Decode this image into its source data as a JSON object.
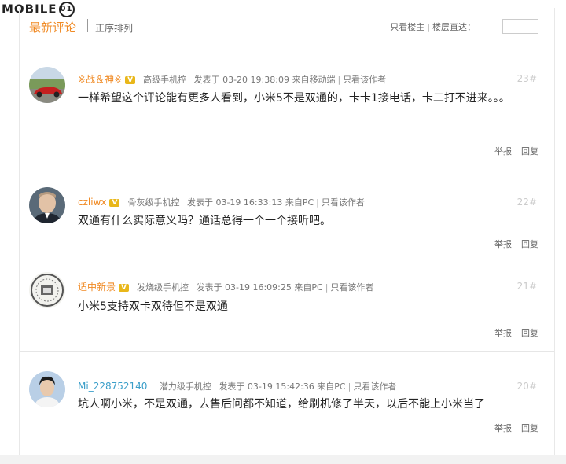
{
  "watermark": {
    "text": "MOBILE",
    "mark": "01"
  },
  "header": {
    "tab_latest": "最新评论",
    "tab_order": "正序排列",
    "only_owner": "只看楼主",
    "floor_jump": "楼层直达："
  },
  "comments": [
    {
      "name": "※战＆神※",
      "badge": "V",
      "rank": "高级手机控",
      "posted_label": "发表于",
      "time": "03-20 19:38:09",
      "source": "来自移动端",
      "only_author": "只看该作者",
      "floor": "23#",
      "text": "一样希望这个评论能有更多人看到，小米5不是双通的，卡卡1接电话，卡二打不进来。。。",
      "report": "举报",
      "reply": "回复",
      "avatar_icon": "red-car-avatar"
    },
    {
      "name": "czliwx",
      "badge": "V",
      "rank": "骨灰级手机控",
      "posted_label": "发表于",
      "time": "03-19 16:33:13",
      "source": "来自PC",
      "only_author": "只看该作者",
      "floor": "22#",
      "text": "双通有什么实际意义吗？通话总得一个一个接听吧。",
      "report": "举报",
      "reply": "回复",
      "avatar_icon": "portrait-avatar"
    },
    {
      "name": "适中新景",
      "badge": "V",
      "rank": "发烧级手机控",
      "posted_label": "发表于",
      "time": "03-19 16:09:25",
      "source": "来自PC",
      "only_author": "只看该作者",
      "floor": "21#",
      "text": "小米5支持双卡双待但不是双通",
      "report": "举报",
      "reply": "回复",
      "avatar_icon": "seal-avatar"
    },
    {
      "name": "Mi_228752140",
      "rank": "潜力级手机控",
      "posted_label": "发表于",
      "time": "03-19 15:42:36",
      "source": "来自PC",
      "only_author": "只看该作者",
      "floor": "20#",
      "text": "坑人啊小米，不是双通，去售后问都不知道，给刷机修了半天，以后不能上小米当了",
      "report": "举报",
      "reply": "回复",
      "avatar_icon": "person-avatar"
    }
  ]
}
